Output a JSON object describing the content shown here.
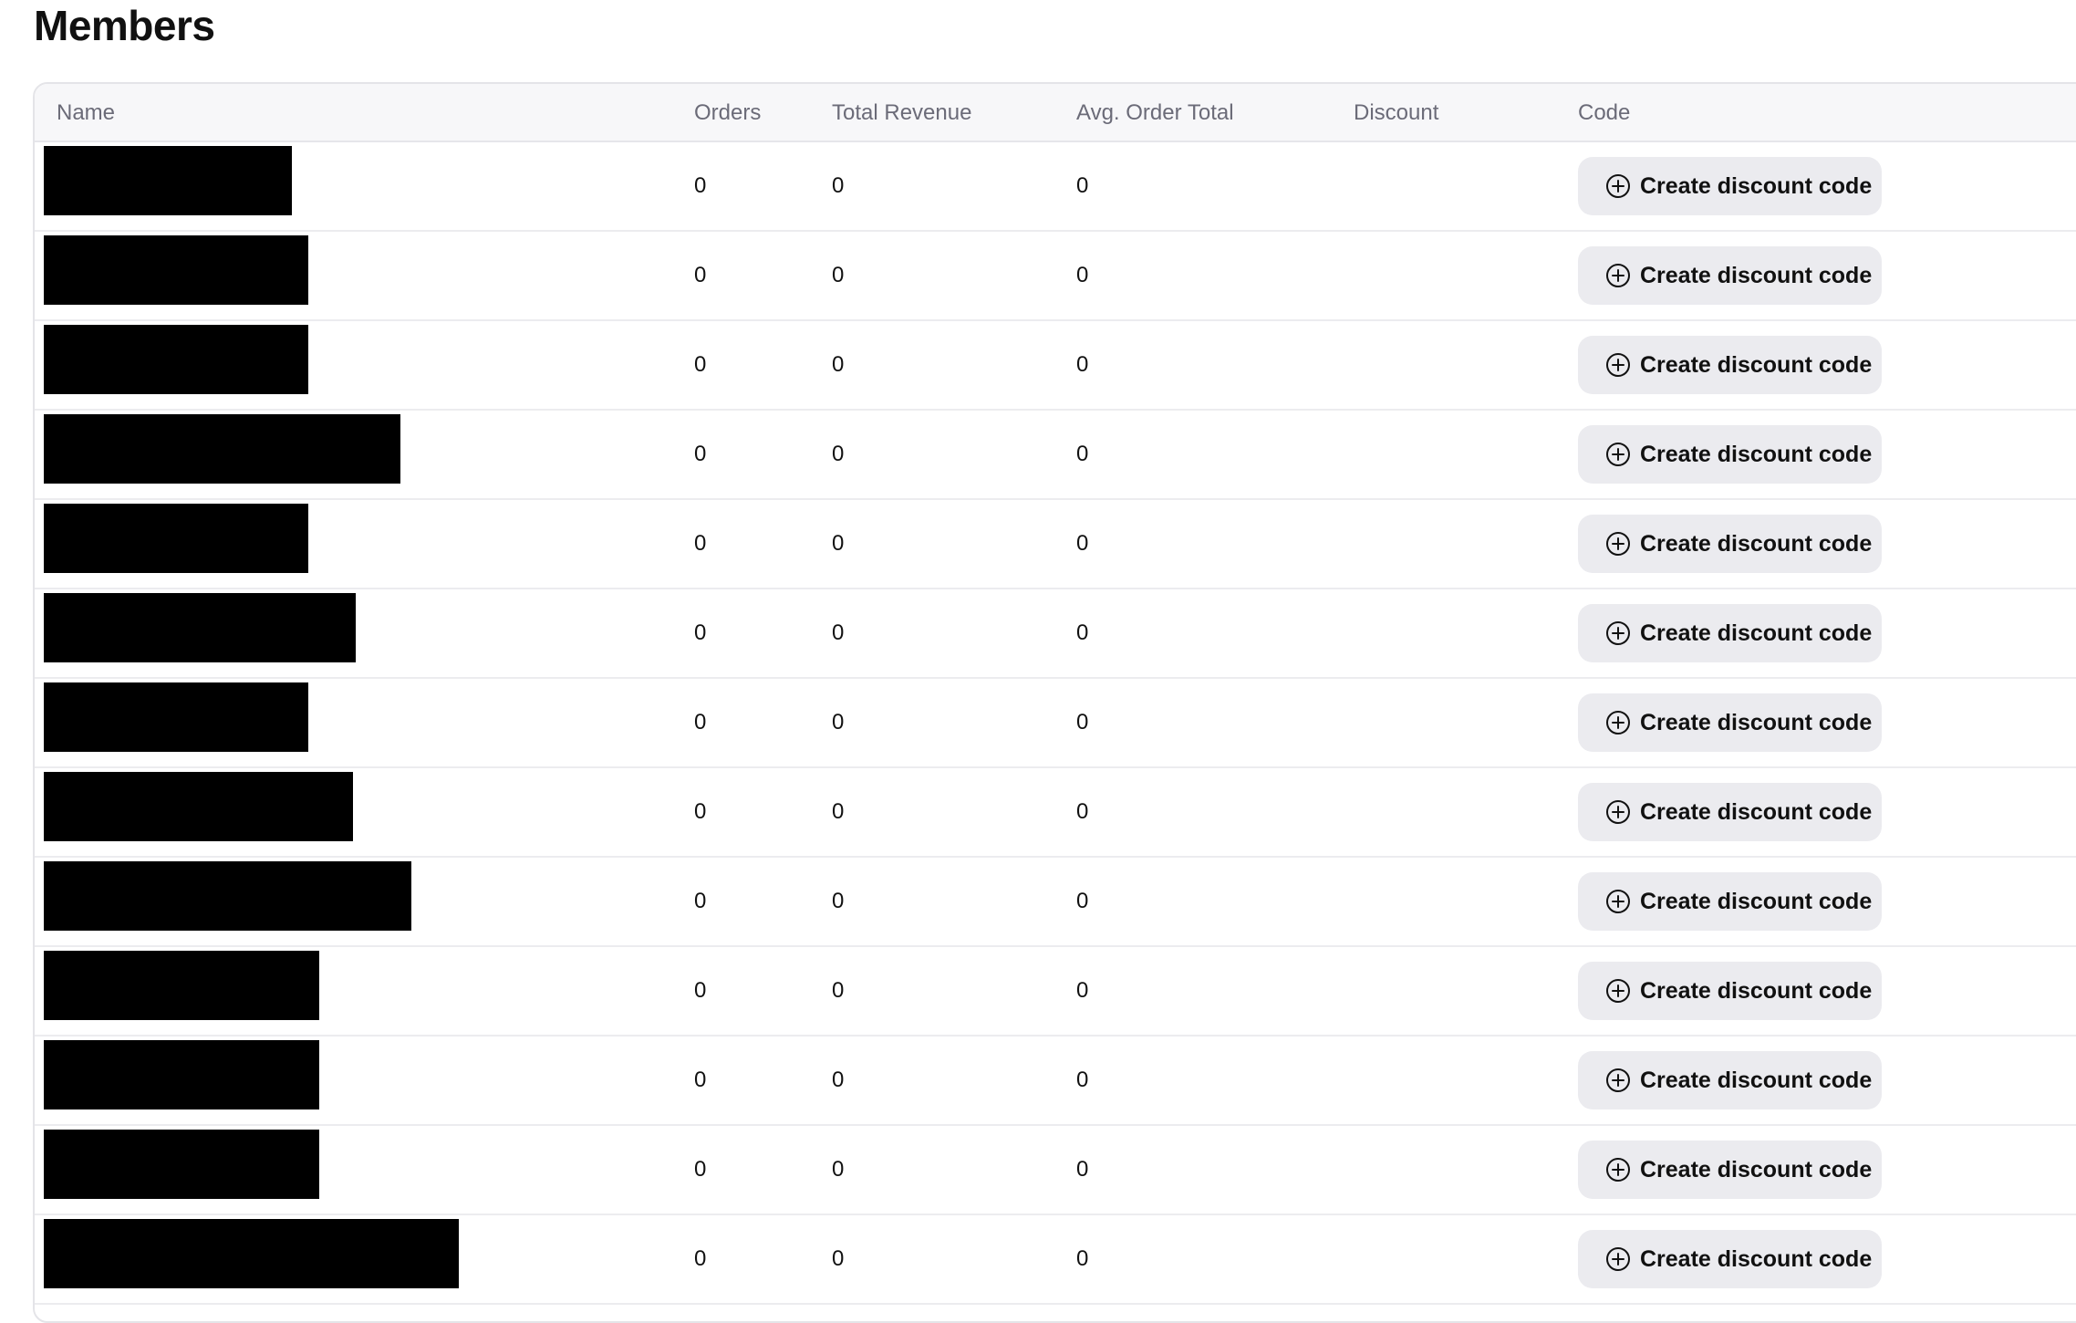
{
  "page": {
    "title": "Members"
  },
  "table": {
    "columns": {
      "name": "Name",
      "orders": "Orders",
      "total_revenue": "Total Revenue",
      "avg_order_total": "Avg. Order Total",
      "discount": "Discount",
      "code": "Code"
    },
    "rows": [
      {
        "name": "[redacted]",
        "orders": "0",
        "total_revenue": "0",
        "avg_order_total": "0",
        "discount": "",
        "code_button": "Create discount code"
      },
      {
        "name": "[redacted]",
        "orders": "0",
        "total_revenue": "0",
        "avg_order_total": "0",
        "discount": "",
        "code_button": "Create discount code"
      },
      {
        "name": "[redacted]",
        "orders": "0",
        "total_revenue": "0",
        "avg_order_total": "0",
        "discount": "",
        "code_button": "Create discount code"
      },
      {
        "name": "[redacted]",
        "orders": "0",
        "total_revenue": "0",
        "avg_order_total": "0",
        "discount": "",
        "code_button": "Create discount code"
      },
      {
        "name": "[redacted]",
        "orders": "0",
        "total_revenue": "0",
        "avg_order_total": "0",
        "discount": "",
        "code_button": "Create discount code"
      },
      {
        "name": "[redacted]",
        "orders": "0",
        "total_revenue": "0",
        "avg_order_total": "0",
        "discount": "",
        "code_button": "Create discount code"
      },
      {
        "name": "[redacted]",
        "orders": "0",
        "total_revenue": "0",
        "avg_order_total": "0",
        "discount": "",
        "code_button": "Create discount code"
      },
      {
        "name": "[redacted]",
        "orders": "0",
        "total_revenue": "0",
        "avg_order_total": "0",
        "discount": "",
        "code_button": "Create discount code"
      },
      {
        "name": "[redacted]",
        "orders": "0",
        "total_revenue": "0",
        "avg_order_total": "0",
        "discount": "",
        "code_button": "Create discount code"
      },
      {
        "name": "[redacted]",
        "orders": "0",
        "total_revenue": "0",
        "avg_order_total": "0",
        "discount": "",
        "code_button": "Create discount code"
      },
      {
        "name": "[redacted]",
        "orders": "0",
        "total_revenue": "0",
        "avg_order_total": "0",
        "discount": "",
        "code_button": "Create discount code"
      },
      {
        "name": "[redacted]",
        "orders": "0",
        "total_revenue": "0",
        "avg_order_total": "0",
        "discount": "",
        "code_button": "Create discount code"
      },
      {
        "name": "[redacted]",
        "orders": "0",
        "total_revenue": "0",
        "avg_order_total": "0",
        "discount": "",
        "code_button": "Create discount code"
      }
    ]
  },
  "icons": {
    "create_button_icon": "plus-circle-icon"
  },
  "colors": {
    "header_bg": "#f7f7f9",
    "header_text": "#6b6b78",
    "button_bg": "#ebebef",
    "border": "#e6e6ea",
    "redaction": "#000000"
  }
}
